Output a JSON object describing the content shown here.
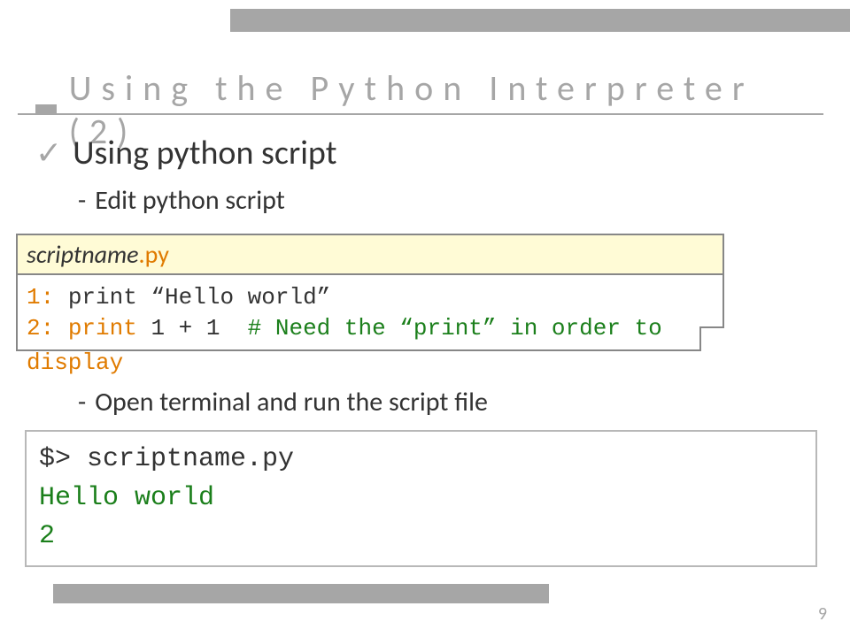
{
  "title": "Using the Python Interpreter (2)",
  "bullets": {
    "b1": "Using python script",
    "b2": "Edit python script",
    "b3": "Open terminal and run the script file"
  },
  "file": {
    "name": "scriptname",
    "ext": ".py",
    "line1_num": "1:",
    "line1_kw": " print ",
    "line1_rest": "“Hello world”",
    "line2_num": "2:",
    "line2_kw": " print ",
    "line2_mid": "1 + 1  ",
    "line2_comment": "# Need the “print” in order to",
    "overflow": "display"
  },
  "terminal": {
    "cmd": "$> scriptname.py",
    "out1": "Hello world",
    "out2": "2"
  },
  "page_number": "9"
}
